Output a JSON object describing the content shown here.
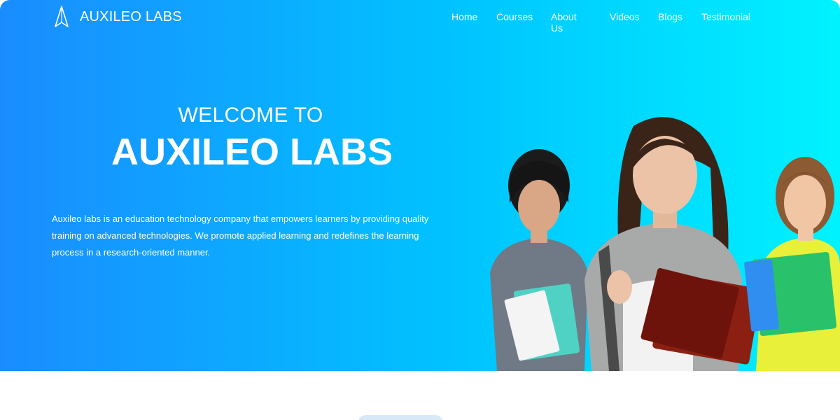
{
  "brand": {
    "name": "AUXILEO LABS"
  },
  "nav": {
    "items": [
      {
        "label": "Home"
      },
      {
        "label": "Courses"
      },
      {
        "label": "About Us"
      },
      {
        "label": "Videos"
      },
      {
        "label": "Blogs"
      },
      {
        "label": "Testimonial"
      }
    ]
  },
  "hero": {
    "welcome": "WELCOME TO",
    "title": "AUXILEO LABS",
    "description": "Auxileo labs is an education technology company that empowers learners by providing quality training on advanced technologies. We promote applied learning and redefines the learning process in a research-oriented manner."
  },
  "colors": {
    "gradient_start": "#1a8cff",
    "gradient_end": "#00f2ff",
    "text": "#ffffff"
  },
  "icons": {
    "brand_logo": "rocket-logo-icon"
  }
}
